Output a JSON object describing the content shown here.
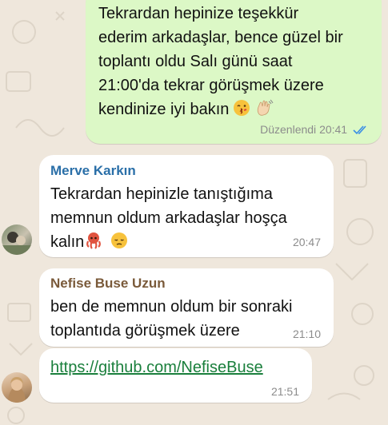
{
  "outgoing": {
    "lines": [
      "Tekrardan hepinize teşekkür",
      "ederim arkadaşlar, bence güzel bir",
      "toplantı oldu Salı günü saat",
      "21:00'da tekrar görüşmek üzere",
      "kendinize iyi bakın"
    ],
    "emojis": [
      "kissing-face-emoji",
      "waving-hand-emoji"
    ],
    "edited_label": "Düzenlendi",
    "time": "20:41",
    "read_status": "read-double-check"
  },
  "messages": [
    {
      "sender": "Merve Karkın",
      "sender_color": "#2a6fa8",
      "lines": [
        "Tekrardan hepinizle tanıştığıma",
        "memnun oldum arkadaşlar hoşça",
        "kalın"
      ],
      "emojis": [
        "octopus-emoji",
        "pensive-face-emoji"
      ],
      "time": "20:47"
    },
    {
      "sender": "Nefise Buse Uzun",
      "sender_color": "#7a5a3a",
      "lines": [
        "ben de memnun oldum bir sonraki",
        "toplantıda görüşmek üzere"
      ],
      "time": "21:10"
    },
    {
      "link": "https://github.com/NefiseBuse",
      "time": "21:51"
    }
  ]
}
